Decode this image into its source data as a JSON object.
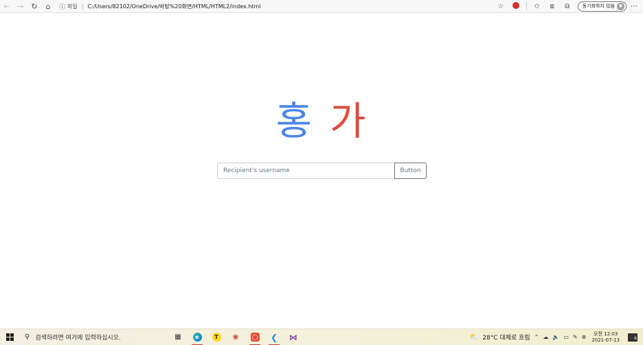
{
  "browser": {
    "site_info_label": "파일",
    "separator": "|",
    "url": "C:/Users/82102/OneDrive/바탕%20화면/HTML/HTML2/index.html",
    "profile_label": "동기화하지 않음",
    "icons": [
      "back-icon",
      "forward-icon",
      "refresh-icon",
      "home-icon",
      "info-icon",
      "favorites-add-icon",
      "extension-icon",
      "favorites-icon",
      "collections-icon",
      "share-icon",
      "more-icon"
    ]
  },
  "page": {
    "hero_word_1": "홍",
    "hero_word_2": "가",
    "hero_color_1": "#4a86e8",
    "hero_color_2": "#e04a3f",
    "input_placeholder": "Recipient's username",
    "input_value": "",
    "button_label": "Button"
  },
  "taskbar": {
    "search_placeholder": "검색하려면 여기에 입력하십시오.",
    "apps": [
      "task-view",
      "edge",
      "kakaotalk",
      "pinwheel-app",
      "red-app",
      "vscode",
      "visual-studio"
    ],
    "weather": "28°C 대체로 흐림",
    "time": "오전 12:03",
    "date": "2021-07-13",
    "notification_count": "6"
  }
}
